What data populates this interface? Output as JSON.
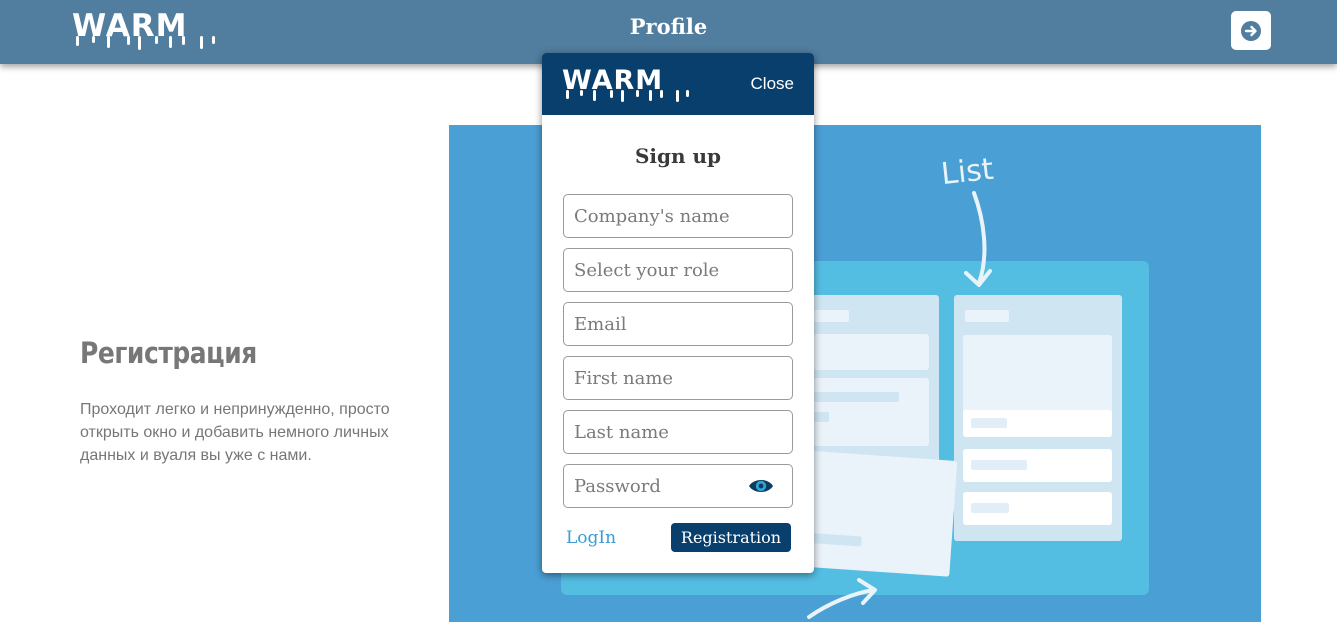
{
  "header": {
    "logo": "WARM",
    "title": "Profile",
    "logout_icon": "arrow-right-circle-icon"
  },
  "intro": {
    "heading": "Регистрация",
    "description": "Проходит легко и непринужденно, просто открыть окно и добавить немного личных данных и вуаля вы уже с нами."
  },
  "illustration": {
    "label": "List"
  },
  "modal": {
    "logo": "WARM",
    "close_label": "Close",
    "title": "Sign up",
    "fields": {
      "company": {
        "placeholder": "Company's name",
        "value": ""
      },
      "role": {
        "placeholder": "Select your role",
        "value": ""
      },
      "email": {
        "placeholder": "Email",
        "value": ""
      },
      "first_name": {
        "placeholder": "First name",
        "value": ""
      },
      "last_name": {
        "placeholder": "Last name",
        "value": ""
      },
      "password": {
        "placeholder": "Password",
        "value": ""
      }
    },
    "password_toggle_icon": "eye-icon",
    "login_label": "LogIn",
    "register_label": "Registration"
  },
  "colors": {
    "topbar": "#517d9e",
    "modal_header": "#083f6d",
    "illustration_bg": "#4a9fd4",
    "link": "#3a9cd6"
  }
}
